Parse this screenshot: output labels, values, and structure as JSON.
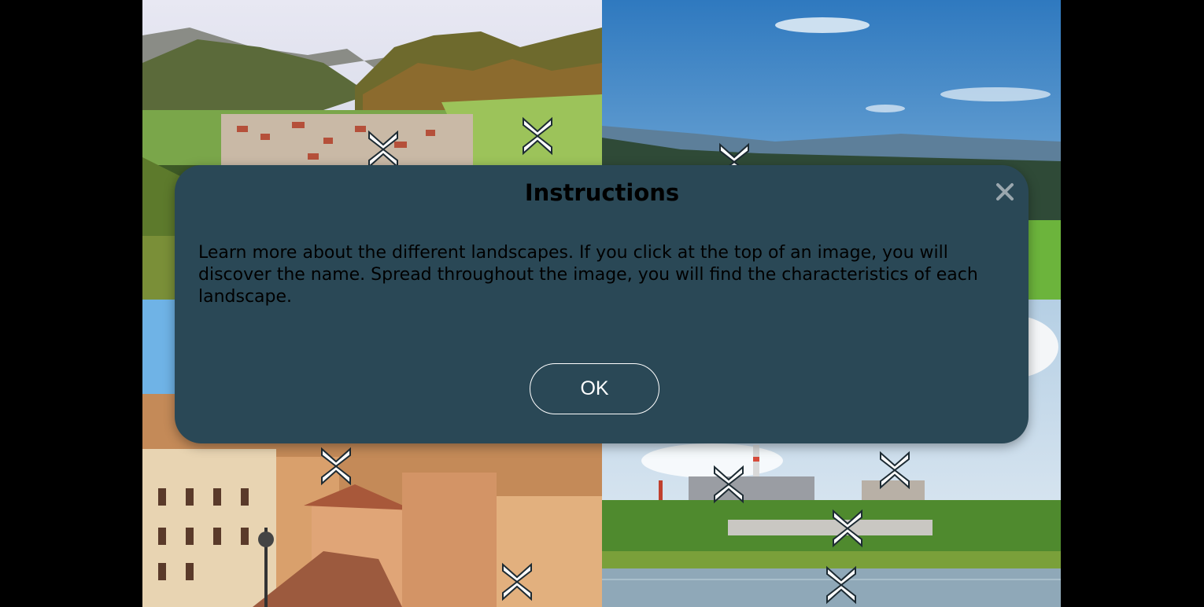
{
  "panels": [
    {
      "name": "mountain-valley-village",
      "description_icon": "landscape-photo"
    },
    {
      "name": "blue-sky-hills",
      "description_icon": "landscape-photo"
    },
    {
      "name": "old-city-rooftops",
      "description_icon": "landscape-photo"
    },
    {
      "name": "industrial-lakeside",
      "description_icon": "landscape-photo"
    }
  ],
  "hotspot_icon": "collapse-arrows-icon",
  "modal": {
    "title": "Instructions",
    "body": "Learn more about the different landscapes. If you click at the top of an image, you will discover the name. Spread throughout the image, you will find the characteristics of each landscape.",
    "ok_label": "OK",
    "close_icon": "close-icon"
  },
  "colors": {
    "modal_bg": "#2a4856",
    "page_bg": "#000000",
    "text": "#ffffff"
  }
}
